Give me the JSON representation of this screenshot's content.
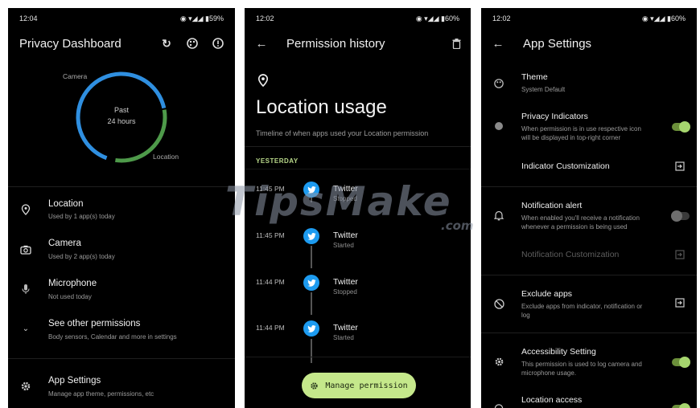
{
  "screen1": {
    "time": "12:04",
    "status_icons": "◉ ▾◢◢ ▮59%",
    "title": "Privacy Dashboard",
    "actions": [
      "refresh-icon",
      "palette-icon",
      "info-icon"
    ],
    "chart": {
      "center_line1": "Past",
      "center_line2": "24 hours",
      "label_camera": "Camera",
      "label_location": "Location",
      "colors": {
        "camera": "#2f8fe0",
        "location": "#4e9a4a"
      }
    },
    "items": [
      {
        "title": "Location",
        "sub": "Used by 1 app(s) today",
        "icon": "location-pin-icon"
      },
      {
        "title": "Camera",
        "sub": "Used by 2 app(s) today",
        "icon": "camera-icon"
      },
      {
        "title": "Microphone",
        "sub": "Not used today",
        "icon": "microphone-icon"
      },
      {
        "title": "See other permissions",
        "sub": "Body sensors, Calendar and more in settings",
        "icon": "chevron-down-icon"
      }
    ],
    "settings": {
      "title": "App Settings",
      "sub": "Manage app theme, permissions, etc",
      "icon": "gear-icon"
    }
  },
  "screen2": {
    "time": "12:02",
    "status_icons": "◉ ▾◢◢ ▮60%",
    "title": "Permission history",
    "heading": "Location usage",
    "subheading": "Timeline of when apps used your Location permission",
    "section": "YESTERDAY",
    "events": [
      {
        "time": "11:45 PM",
        "app": "Twitter",
        "state": "Stopped"
      },
      {
        "time": "11:45 PM",
        "app": "Twitter",
        "state": "Started"
      },
      {
        "time": "11:44 PM",
        "app": "Twitter",
        "state": "Stopped"
      },
      {
        "time": "11:44 PM",
        "app": "Twitter",
        "state": "Started"
      }
    ],
    "fab_label": "Manage permission",
    "accent": "#c5e88b"
  },
  "screen3": {
    "time": "12:02",
    "status_icons": "◉ ▾◢◢ ▮60%",
    "title": "App Settings",
    "theme": {
      "title": "Theme",
      "sub": "System Default"
    },
    "privacy_indicators": {
      "title": "Privacy Indicators",
      "sub1": "When permission is in use respective icon",
      "sub2": "will be displayed in top-right corner",
      "enabled": true
    },
    "indicator_customization": "Indicator Customization",
    "notification_alert": {
      "title": "Notification alert",
      "sub1": "When enabled you'll receive a notification",
      "sub2": "whenever a permission is being used",
      "enabled": false
    },
    "notification_customization": "Notification Customization",
    "exclude_apps": {
      "title": "Exclude apps",
      "sub1": "Exclude apps from indicator, notification or",
      "sub2": "log"
    },
    "accessibility": {
      "title": "Accessibility Setting",
      "sub1": "This permission is used to log camera and",
      "sub2": "microphone usage.",
      "enabled": true
    },
    "location_access": {
      "title": "Location access",
      "enabled": true
    }
  },
  "watermark": {
    "main": "TipsMake",
    "suffix": ".com"
  }
}
